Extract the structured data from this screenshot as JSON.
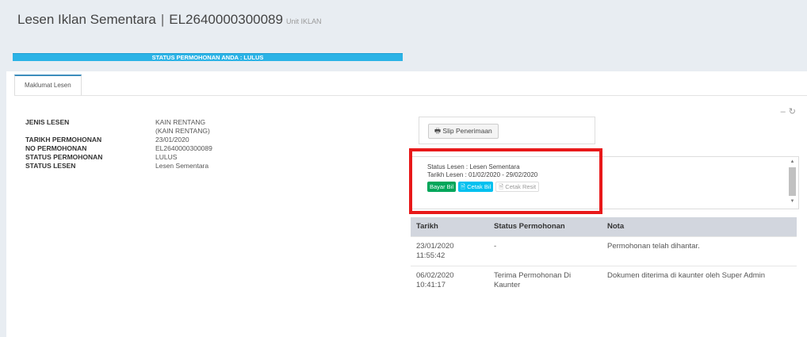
{
  "header": {
    "title": "Lesen Iklan Sementara",
    "separator": "|",
    "license_no": "EL2640000300089",
    "unit": "Unit IKLAN"
  },
  "status_banner": "STATUS PERMOHONAN ANDA : LULUS",
  "tabs": [
    {
      "label": "Maklumat Lesen"
    }
  ],
  "tools": {
    "minimize": "–",
    "refresh": "↻"
  },
  "info": {
    "jenis_lesen_label": "JENIS LESEN",
    "jenis_lesen_value": "KAIN RENTANG",
    "jenis_lesen_sub": "(KAIN RENTANG)",
    "tarikh_label": "TARIKH PERMOHONAN",
    "tarikh_value": "23/01/2020",
    "no_label": "NO PERMOHONAN",
    "no_value": "EL2640000300089",
    "status_perm_label": "STATUS PERMOHONAN",
    "status_perm_value": "LULUS",
    "status_lesen_label": "STATUS LESEN",
    "status_lesen_value": "Lesen Sementara"
  },
  "slip_button": "Slip Penerimaan",
  "license_status": {
    "status_line": "Status Lesen : Lesen Sementara",
    "date_line": "Tarikh Lesen : 01/02/2020 - 29/02/2020",
    "bayar_bil": "Bayar Bil",
    "cetak_bil": "Cetak Bil",
    "cetak_resit": "Cetak Resit"
  },
  "history": {
    "headers": [
      "Tarikh",
      "Status Permohonan",
      "Nota"
    ],
    "rows": [
      {
        "tarikh": "23/01/2020 11:55:42",
        "status": "-",
        "nota": "Permohonan telah dihantar."
      },
      {
        "tarikh": "06/02/2020 10:41:17",
        "status": "Terima Permohonan Di Kaunter",
        "nota": "Dokumen diterima di kaunter oleh Super Admin"
      }
    ]
  },
  "colors": {
    "accent": "#2bb3e6",
    "highlight": "#e8191a",
    "green": "#00a65a",
    "cyan": "#00c0ef"
  }
}
